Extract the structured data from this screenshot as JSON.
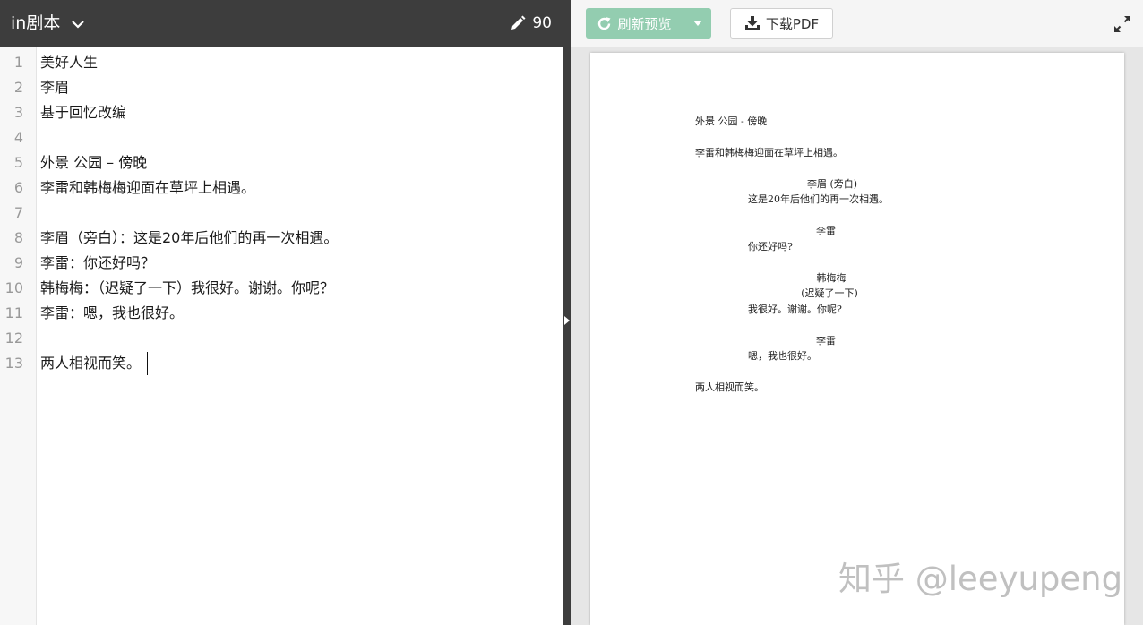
{
  "header": {
    "app_title": "in剧本",
    "word_count": "90"
  },
  "editor": {
    "line_numbers": [
      "1",
      "2",
      "3",
      "4",
      "5",
      "6",
      "7",
      "8",
      "9",
      "10",
      "11",
      "12",
      "13"
    ],
    "lines": [
      "美好人生",
      "李眉",
      "基于回忆改编",
      "",
      "外景 公园 – 傍晚",
      "李雷和韩梅梅迎面在草坪上相遇。",
      "",
      "李眉（旁白）：这是20年后他们的再一次相遇。",
      "李雷：你还好吗？",
      "韩梅梅：（迟疑了一下）我很好。谢谢。你呢？",
      "李雷：嗯，我也很好。",
      "",
      "两人相视而笑。"
    ]
  },
  "toolbar": {
    "refresh_label": "刷新预览",
    "download_label": "下载PDF"
  },
  "preview": {
    "scene_heading": "外景 公园 - 傍晚",
    "action_1": "李雷和韩梅梅迎面在草坪上相遇。",
    "char_1": "李眉 (旁白)",
    "dialog_1": "这是20年后他们的再一次相遇。",
    "char_2": "李雷",
    "dialog_2": "你还好吗?",
    "char_3": "韩梅梅",
    "paren_3": "(迟疑了一下)",
    "dialog_3": "我很好。谢谢。你呢?",
    "char_4": "李雷",
    "dialog_4": "嗯，我也很好。",
    "action_2": "两人相视而笑。"
  },
  "watermark": "知乎 @leeyupeng",
  "colors": {
    "topbar": "#3d3d3d",
    "refresh_button": "#93cdb0",
    "preview_bg": "#e6e6e6"
  }
}
